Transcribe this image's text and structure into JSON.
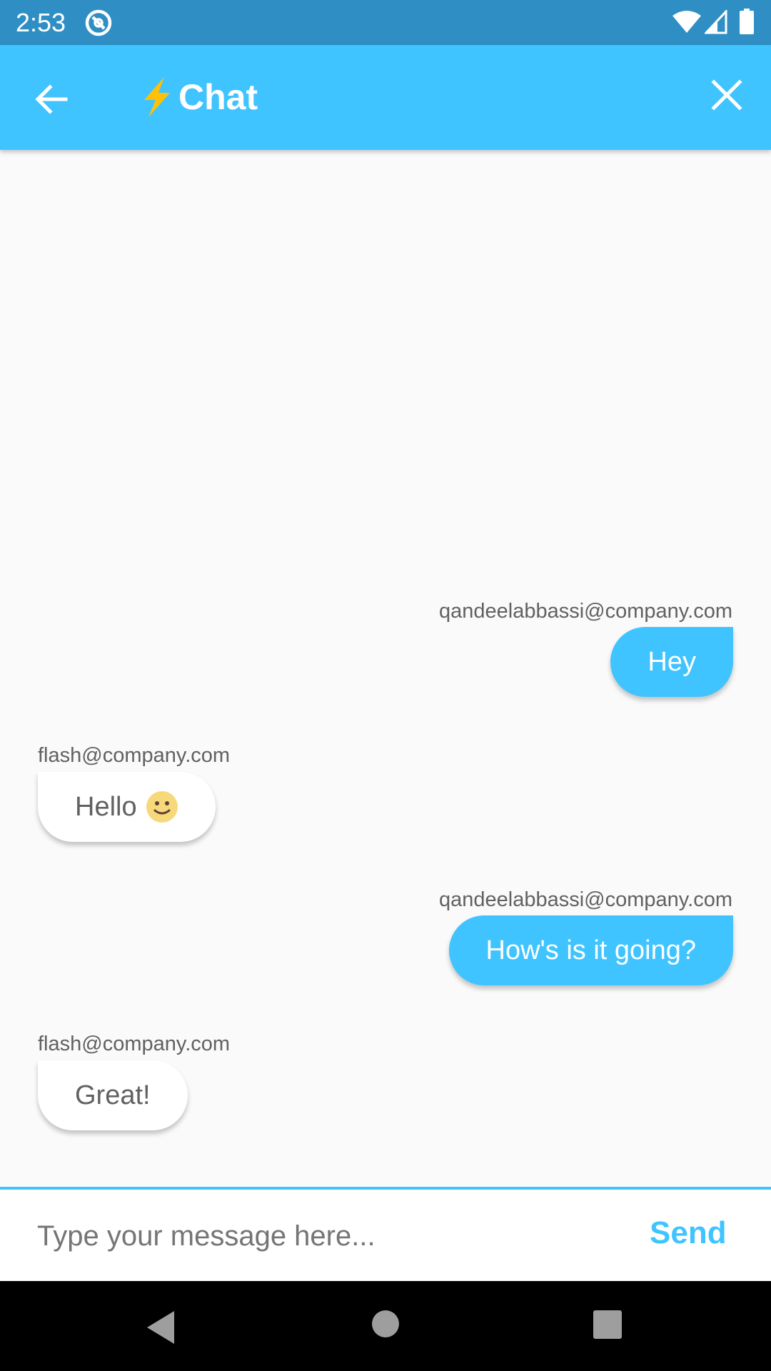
{
  "status_bar": {
    "time": "2:53",
    "icons": [
      "app-notification-icon",
      "wifi-icon",
      "signal-icon",
      "battery-icon"
    ]
  },
  "app_bar": {
    "title": "Chat",
    "title_icon": "lightning-bolt-icon",
    "back_icon": "arrow-back-icon",
    "close_icon": "close-icon",
    "background": "#40c4ff"
  },
  "messages": [
    {
      "sender": "qandeelabbassi@company.com",
      "text": "Hey",
      "mine": true
    },
    {
      "sender": "flash@company.com",
      "text": "Hello",
      "emoji": "slightly-smiling-face-icon",
      "mine": false
    },
    {
      "sender": "qandeelabbassi@company.com",
      "text": "How's is it going?",
      "mine": true
    },
    {
      "sender": "flash@company.com",
      "text": "Great!",
      "mine": false
    }
  ],
  "composer": {
    "placeholder": "Type your message here...",
    "value": "",
    "send_label": "Send"
  },
  "colors": {
    "accent": "#40c4ff",
    "status_bar": "#2f8fc4",
    "background": "#fafafa",
    "sender_text": "#616161"
  }
}
